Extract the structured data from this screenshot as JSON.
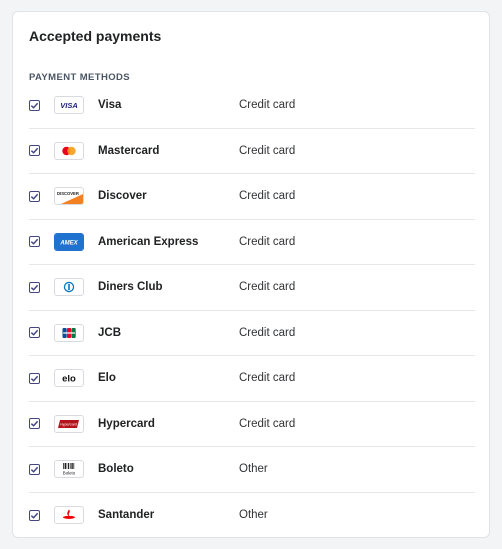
{
  "card": {
    "title": "Accepted payments",
    "section_label": "PAYMENT METHODS"
  },
  "payment_methods": [
    {
      "name": "Visa",
      "type": "Credit card",
      "checked": true,
      "logo": "visa-logo-icon"
    },
    {
      "name": "Mastercard",
      "type": "Credit card",
      "checked": true,
      "logo": "mastercard-logo-icon"
    },
    {
      "name": "Discover",
      "type": "Credit card",
      "checked": true,
      "logo": "discover-logo-icon"
    },
    {
      "name": "American Express",
      "type": "Credit card",
      "checked": true,
      "logo": "amex-logo-icon"
    },
    {
      "name": "Diners Club",
      "type": "Credit card",
      "checked": true,
      "logo": "diners-club-logo-icon"
    },
    {
      "name": "JCB",
      "type": "Credit card",
      "checked": true,
      "logo": "jcb-logo-icon"
    },
    {
      "name": "Elo",
      "type": "Credit card",
      "checked": true,
      "logo": "elo-logo-icon"
    },
    {
      "name": "Hypercard",
      "type": "Credit card",
      "checked": true,
      "logo": "hypercard-logo-icon"
    },
    {
      "name": "Boleto",
      "type": "Other",
      "checked": true,
      "logo": "boleto-logo-icon"
    },
    {
      "name": "Santander",
      "type": "Other",
      "checked": true,
      "logo": "santander-logo-icon"
    }
  ],
  "colors": {
    "checkbox": "#43467f",
    "amex": "#1f72cd",
    "discover_orange": "#f48024",
    "mastercard_red": "#eb001b",
    "mastercard_yellow": "#f79e1b",
    "hypercard_red": "#b3131b",
    "santander_red": "#ec0000"
  },
  "logo_text": {
    "visa": "VISA",
    "discover": "DISCOVER",
    "amex": "AMEX",
    "elo": "elo",
    "hypercard": "Hypercard",
    "boleto": "Boleto"
  }
}
